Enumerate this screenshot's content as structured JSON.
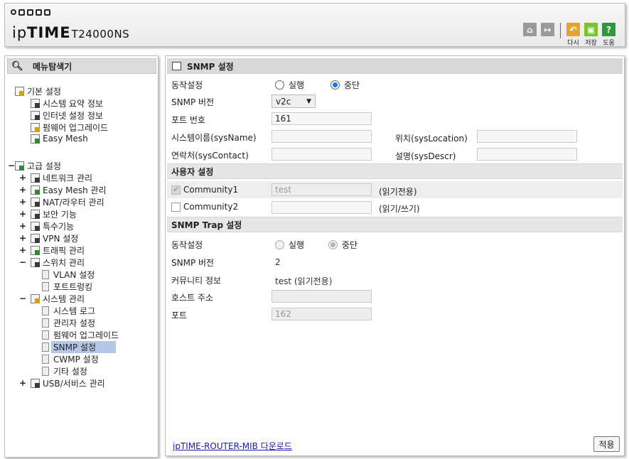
{
  "header": {
    "brand_ip": "ip",
    "brand_name": "TIME",
    "model": "T24000NS",
    "buttons": [
      {
        "icon": "home-icon",
        "label": ""
      },
      {
        "icon": "logout-icon",
        "label": ""
      },
      {
        "icon": "undo-icon",
        "label": "다시"
      },
      {
        "icon": "save-icon",
        "label": "저장"
      },
      {
        "icon": "help-icon",
        "label": "도움",
        "glyph": "?"
      }
    ]
  },
  "sidebar": {
    "title": "메뉴탐색기",
    "groups": [
      {
        "toggle": "",
        "label": "기본 설정"
      },
      {
        "toggle": "−",
        "label": "고급 설정"
      }
    ],
    "basic_items": [
      "시스템 요약 정보",
      "인터넷 설정 정보",
      "펌웨어 업그레이드",
      "Easy Mesh"
    ],
    "advanced_items": [
      {
        "toggle": "+",
        "label": "네트워크 관리"
      },
      {
        "toggle": "+",
        "label": "Easy Mesh 관리"
      },
      {
        "toggle": "+",
        "label": "NAT/라우터 관리"
      },
      {
        "toggle": "+",
        "label": "보안 기능"
      },
      {
        "toggle": "+",
        "label": "특수기능"
      },
      {
        "toggle": "+",
        "label": "VPN 설정"
      },
      {
        "toggle": "+",
        "label": "트래픽 관리"
      },
      {
        "toggle": "−",
        "label": "스위치 관리"
      }
    ],
    "switch_items": [
      "VLAN 설정",
      "포트트렁킹"
    ],
    "system_group": {
      "toggle": "−",
      "label": "시스템 관리"
    },
    "system_items": [
      "시스템 로그",
      "관리자 설정",
      "펌웨어 업그레이드",
      "SNMP 설정",
      "CWMP 설정",
      "기타 설정"
    ],
    "selected": "SNMP 설정",
    "usb_group": {
      "toggle": "+",
      "label": "USB/서비스 관리"
    }
  },
  "snmp": {
    "section_title": "SNMP 설정",
    "status_label": "동작설정",
    "run_label": "실행",
    "stop_label": "중단",
    "status_value": "stop",
    "version_label": "SNMP 버전",
    "version_value": "v2c",
    "port_label": "포트 번호",
    "port_value": "161",
    "sysname_label": "시스템이름(sysName)",
    "sysname_value": "",
    "location_label": "위치(sysLocation)",
    "location_value": "",
    "contact_label": "연락처(sysContact)",
    "contact_value": "",
    "descr_label": "설명(sysDescr)",
    "descr_value": ""
  },
  "user": {
    "section_title": "사용자 설정",
    "community1_label": "Community1",
    "community1_value": "test",
    "community1_checked": true,
    "community1_mode": "(읽기전용)",
    "community2_label": "Community2",
    "community2_value": "",
    "community2_checked": false,
    "community2_mode": "(읽기/쓰기)"
  },
  "trap": {
    "section_title": "SNMP Trap 설정",
    "status_label": "동작설정",
    "run_label": "실행",
    "stop_label": "중단",
    "status_value": "stop",
    "version_label": "SNMP 버전",
    "version_value": "2",
    "community_label": "커뮤니티 정보",
    "community_value": "test (읽기전용)",
    "host_label": "호스트 주소",
    "host_value": "",
    "port_label": "포트",
    "port_value": "162"
  },
  "footer": {
    "mib_link": "ipTIME-ROUTER-MIB 다운로드",
    "apply_label": "적용"
  }
}
